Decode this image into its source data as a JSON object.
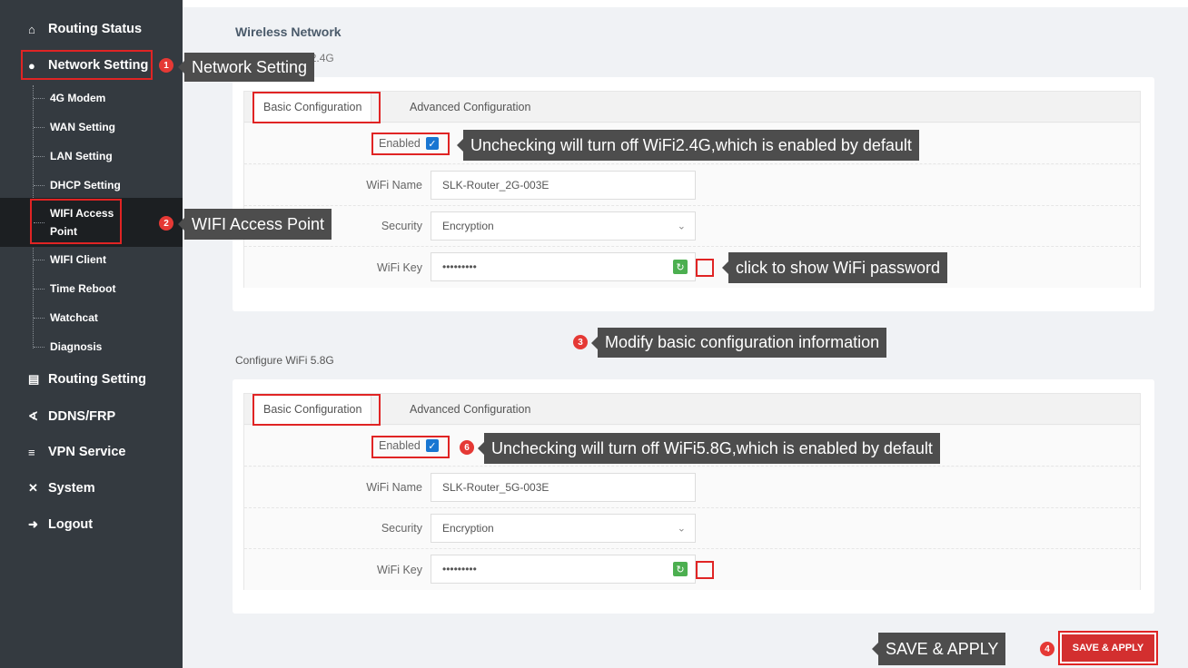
{
  "sidebar": {
    "routing_status": "Routing Status",
    "network_setting": "Network Setting",
    "sub": [
      "4G Modem",
      "WAN Setting",
      "LAN Setting",
      "DHCP Setting",
      "WIFI Access",
      "Point",
      "WIFI Client",
      "Time Reboot",
      "Watchcat",
      "Diagnosis"
    ],
    "routing_setting": "Routing Setting",
    "ddns": "DDNS/FRP",
    "vpn": "VPN Service",
    "system": "System",
    "logout": "Logout"
  },
  "page": {
    "title": "Wireless Network",
    "sub_24": "Configure WiFi 2.4G",
    "sub_58": "Configure WiFi 5.8G"
  },
  "wifi24": {
    "tab_basic": "Basic Configuration",
    "tab_advanced": "Advanced Configuration",
    "enabled": "Enabled",
    "name_label": "WiFi Name",
    "name_value": "SLK-Router_2G-003E",
    "security_label": "Security",
    "security_value": "Encryption",
    "key_label": "WiFi Key",
    "key_value": "•••••••••"
  },
  "wifi58": {
    "tab_basic": "Basic Configuration",
    "tab_advanced": "Advanced Configuration",
    "enabled": "Enabled",
    "name_label": "WiFi Name",
    "name_value": "SLK-Router_5G-003E",
    "security_label": "Security",
    "security_value": "Encryption",
    "key_label": "WiFi Key",
    "key_value": "•••••••••"
  },
  "callouts": {
    "c1": "Network Setting",
    "c2": "WIFI Access Point",
    "c_enable24": "Unchecking will turn off WiFi2.4G,which is enabled by default",
    "c_key": "click to show WiFi password",
    "c3": "Modify basic configuration information",
    "c_enable58": "Unchecking will turn off WiFi5.8G,which is enabled by default",
    "c4": "SAVE & APPLY"
  },
  "badges": {
    "b1": "1",
    "b2": "2",
    "b3": "3",
    "b4": "4",
    "b6": "6"
  },
  "save_button": "SAVE & APPLY",
  "colors": {
    "sidebar": "#343a40",
    "accent_red": "#d32f2f",
    "checkbox": "#1976d2"
  }
}
